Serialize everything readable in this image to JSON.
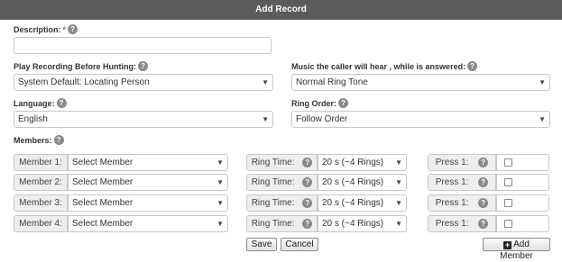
{
  "dialog": {
    "title": "Add Record"
  },
  "form": {
    "description_label": "Description:",
    "description_required": "*",
    "description_value": "",
    "play_recording_label": "Play Recording Before Hunting:",
    "play_recording_value": "System Default: Locating Person",
    "music_label": "Music the caller will hear , while is answered:",
    "music_value": "Normal Ring Tone",
    "language_label": "Language:",
    "language_value": "English",
    "ring_order_label": "Ring Order:",
    "ring_order_value": "Follow Order",
    "members_label": "Members:"
  },
  "members": [
    {
      "label": "Member 1:",
      "select": "Select Member",
      "ring_label": "Ring Time:",
      "ring_value": "20 s (~4 Rings)",
      "press_label": "Press 1:",
      "press_value": ""
    },
    {
      "label": "Member 2:",
      "select": "Select Member",
      "ring_label": "Ring Time:",
      "ring_value": "20 s (~4 Rings)",
      "press_label": "Press 1:",
      "press_value": ""
    },
    {
      "label": "Member 3:",
      "select": "Select Member",
      "ring_label": "Ring Time:",
      "ring_value": "20 s (~4 Rings)",
      "press_label": "Press 1:",
      "press_value": ""
    },
    {
      "label": "Member 4:",
      "select": "Select Member",
      "ring_label": "Ring Time:",
      "ring_value": "20 s (~4 Rings)",
      "press_label": "Press 1:",
      "press_value": ""
    }
  ],
  "actions": {
    "save": "Save",
    "cancel": "Cancel",
    "add_member": "Add Member"
  },
  "icons": {
    "help": "question-circle",
    "dropdown": "caret-down",
    "add": "plus-square"
  },
  "colors": {
    "titlebar": "#5b5b5b",
    "required": "#d9534f",
    "help_icon": "#8a8a8a"
  }
}
